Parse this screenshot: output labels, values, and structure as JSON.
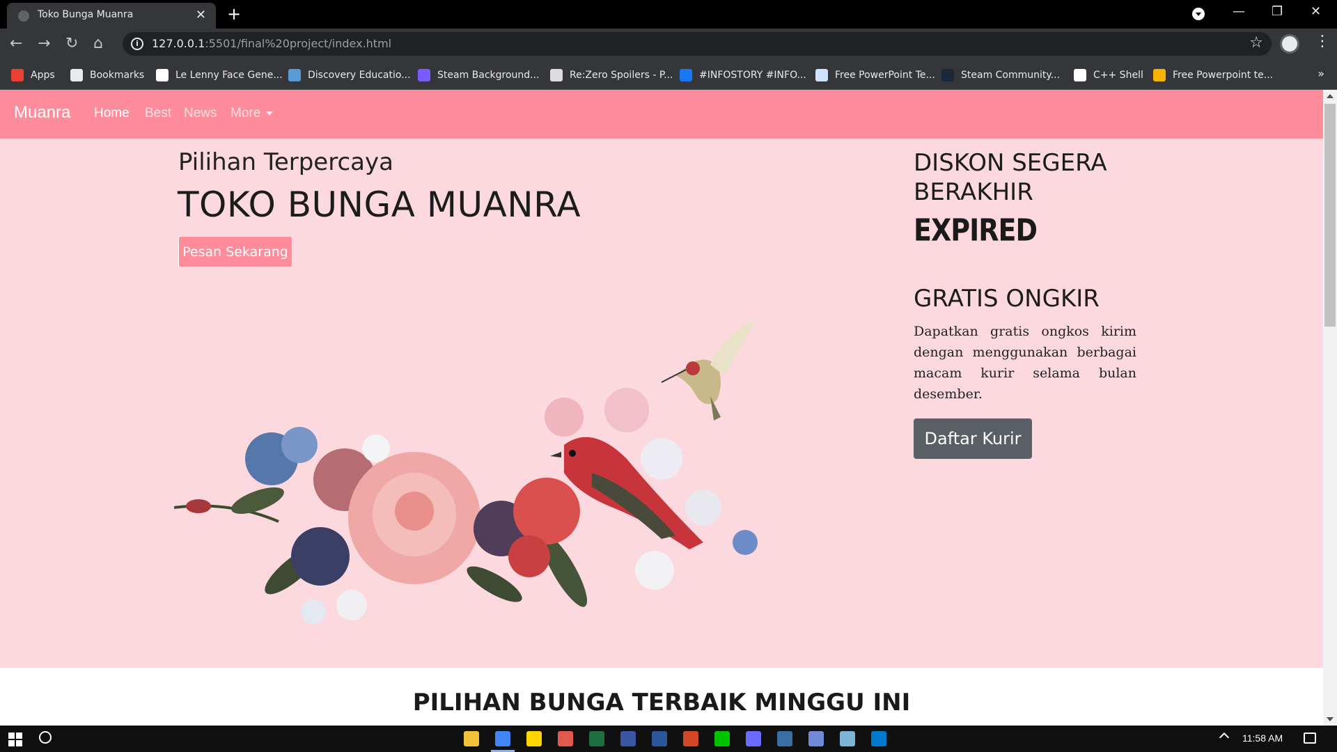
{
  "browser": {
    "tab_title": "Toko Bunga Muanra",
    "new_tab_label": "+",
    "url_host": "127.0.0.1",
    "url_rest": ":5501/final%20project/index.html",
    "bookmarks": [
      {
        "label": "Apps",
        "color": "#e94235"
      },
      {
        "label": "Bookmarks",
        "color": "#e8eaed"
      },
      {
        "label": "Le Lenny Face Gene...",
        "color": "#ffffff"
      },
      {
        "label": "Discovery Educatio...",
        "color": "#5b9bd5"
      },
      {
        "label": "Steam Background...",
        "color": "#7b5cff"
      },
      {
        "label": "Re:Zero Spoilers - P...",
        "color": "#dddddd"
      },
      {
        "label": "#INFOSTORY #INFO...",
        "color": "#1877f2"
      },
      {
        "label": "Free PowerPoint Te...",
        "color": "#cfe2ff"
      },
      {
        "label": "Steam Community...",
        "color": "#1b2838"
      },
      {
        "label": "C++ Shell",
        "color": "#ffffff"
      },
      {
        "label": "Free Powerpoint te...",
        "color": "#f4b400"
      }
    ],
    "more_bookmarks": "»"
  },
  "site": {
    "brand": "Muanra",
    "nav": {
      "home": "Home",
      "best": "Best",
      "news": "News",
      "more": "More"
    },
    "hero": {
      "subtitle": "Pilihan Terpercaya",
      "title": "TOKO BUNGA MUANRA",
      "cta": "Pesan Sekarang"
    },
    "side": {
      "diskon": "DISKON SEGERA BERAKHIR",
      "expired": "EXPIRED",
      "gratis": "GRATIS ONGKIR",
      "desc": "Dapatkan gratis ongkos kirim dengan menggunakan berbagai macam kurir selama bulan desember.",
      "button": "Daftar Kurir"
    },
    "section_title": "PILIHAN BUNGA TERBAIK MINGGU INI"
  },
  "taskbar": {
    "time": "11:58 AM",
    "apps": [
      {
        "name": "file-explorer-icon",
        "color": "#f3c13a"
      },
      {
        "name": "chrome-icon",
        "color": "#4285f4",
        "running": true
      },
      {
        "name": "sticky-notes-icon",
        "color": "#ffd400"
      },
      {
        "name": "paint-icon",
        "color": "#e05a4f"
      },
      {
        "name": "excel-icon",
        "color": "#1d6f42"
      },
      {
        "name": "visio-icon",
        "color": "#3955a3"
      },
      {
        "name": "word-icon",
        "color": "#2b579a"
      },
      {
        "name": "powerpoint-icon",
        "color": "#d24726"
      },
      {
        "name": "line-icon",
        "color": "#00c300"
      },
      {
        "name": "app-icon",
        "color": "#6a6aff"
      },
      {
        "name": "devc-icon",
        "color": "#3a6ea5"
      },
      {
        "name": "discord-icon",
        "color": "#7289da"
      },
      {
        "name": "notepad-icon",
        "color": "#7fb3d5"
      },
      {
        "name": "vscode-icon",
        "color": "#007acc"
      }
    ]
  }
}
